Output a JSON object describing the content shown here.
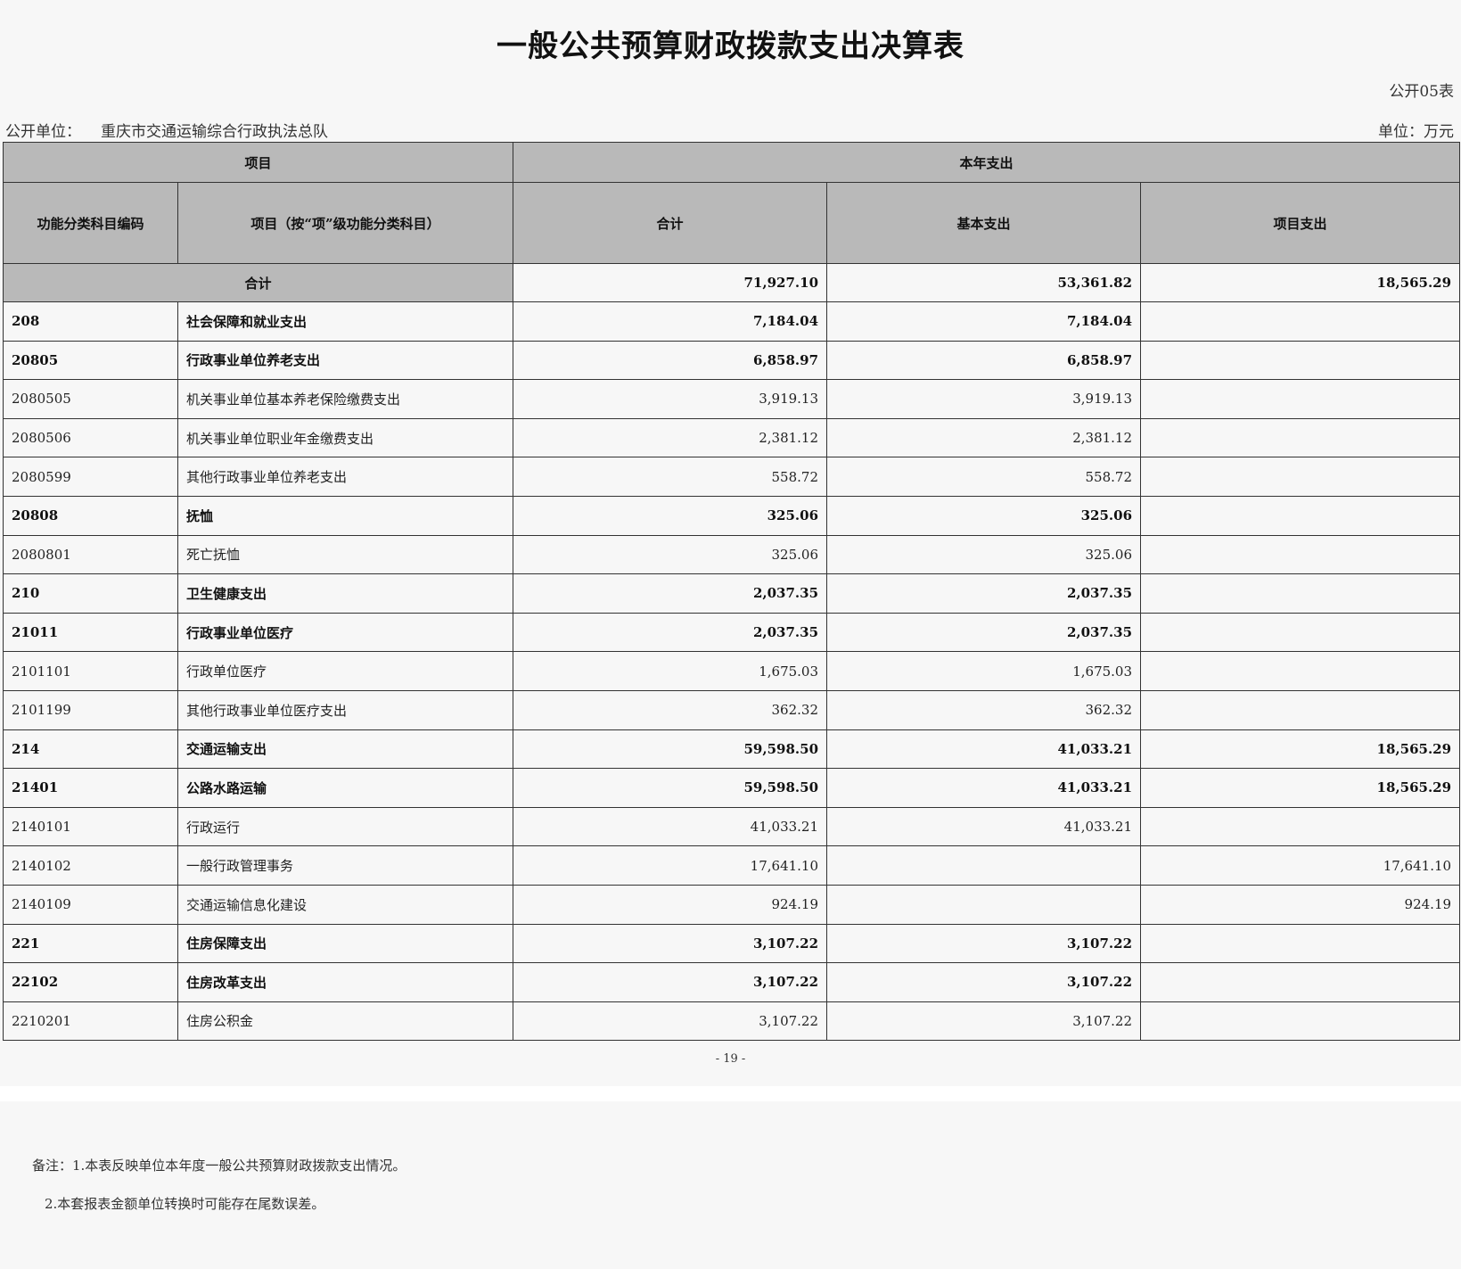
{
  "document": {
    "title": "一般公共预算财政拨款支出决算表",
    "form_no": "公开05表",
    "unit_label": "公开单位：",
    "unit_value": "重庆市交通运输综合行政执法总队",
    "money_unit": "单位：万元",
    "page_number": "- 19 -"
  },
  "table": {
    "header": {
      "project": "项目",
      "current_year": "本年支出",
      "code": "功能分类科目编码",
      "name": "项目（按“项”级功能分类科目）",
      "total": "合计",
      "basic": "基本支出",
      "project_expense": "项目支出"
    },
    "total_row": {
      "label": "合计",
      "total": "71,927.10",
      "basic": "53,361.82",
      "project": "18,565.29"
    },
    "rows": [
      {
        "code": "208",
        "name": "社会保障和就业支出",
        "total": "7,184.04",
        "basic": "7,184.04",
        "project": "",
        "bold": true
      },
      {
        "code": "20805",
        "name": "行政事业单位养老支出",
        "total": "6,858.97",
        "basic": "6,858.97",
        "project": "",
        "bold": true
      },
      {
        "code": "2080505",
        "name": "机关事业单位基本养老保险缴费支出",
        "total": "3,919.13",
        "basic": "3,919.13",
        "project": "",
        "bold": false
      },
      {
        "code": "2080506",
        "name": "机关事业单位职业年金缴费支出",
        "total": "2,381.12",
        "basic": "2,381.12",
        "project": "",
        "bold": false
      },
      {
        "code": "2080599",
        "name": "其他行政事业单位养老支出",
        "total": "558.72",
        "basic": "558.72",
        "project": "",
        "bold": false
      },
      {
        "code": "20808",
        "name": "抚恤",
        "total": "325.06",
        "basic": "325.06",
        "project": "",
        "bold": true
      },
      {
        "code": "2080801",
        "name": "死亡抚恤",
        "total": "325.06",
        "basic": "325.06",
        "project": "",
        "bold": false
      },
      {
        "code": "210",
        "name": "卫生健康支出",
        "total": "2,037.35",
        "basic": "2,037.35",
        "project": "",
        "bold": true
      },
      {
        "code": "21011",
        "name": "行政事业单位医疗",
        "total": "2,037.35",
        "basic": "2,037.35",
        "project": "",
        "bold": true
      },
      {
        "code": "2101101",
        "name": "行政单位医疗",
        "total": "1,675.03",
        "basic": "1,675.03",
        "project": "",
        "bold": false
      },
      {
        "code": "2101199",
        "name": "其他行政事业单位医疗支出",
        "total": "362.32",
        "basic": "362.32",
        "project": "",
        "bold": false
      },
      {
        "code": "214",
        "name": "交通运输支出",
        "total": "59,598.50",
        "basic": "41,033.21",
        "project": "18,565.29",
        "bold": true
      },
      {
        "code": "21401",
        "name": "公路水路运输",
        "total": "59,598.50",
        "basic": "41,033.21",
        "project": "18,565.29",
        "bold": true
      },
      {
        "code": "2140101",
        "name": "行政运行",
        "total": "41,033.21",
        "basic": "41,033.21",
        "project": "",
        "bold": false
      },
      {
        "code": "2140102",
        "name": "一般行政管理事务",
        "total": "17,641.10",
        "basic": "",
        "project": "17,641.10",
        "bold": false
      },
      {
        "code": "2140109",
        "name": "交通运输信息化建设",
        "total": "924.19",
        "basic": "",
        "project": "924.19",
        "bold": false
      },
      {
        "code": "221",
        "name": "住房保障支出",
        "total": "3,107.22",
        "basic": "3,107.22",
        "project": "",
        "bold": true
      },
      {
        "code": "22102",
        "name": "住房改革支出",
        "total": "3,107.22",
        "basic": "3,107.22",
        "project": "",
        "bold": true
      },
      {
        "code": "2210201",
        "name": "住房公积金",
        "total": "3,107.22",
        "basic": "3,107.22",
        "project": "",
        "bold": false
      }
    ]
  },
  "notes": {
    "line1": "备注：1.本表反映单位本年度一般公共预算财政拨款支出情况。",
    "line2": "2.本套报表金额单位转换时可能存在尾数误差。"
  }
}
